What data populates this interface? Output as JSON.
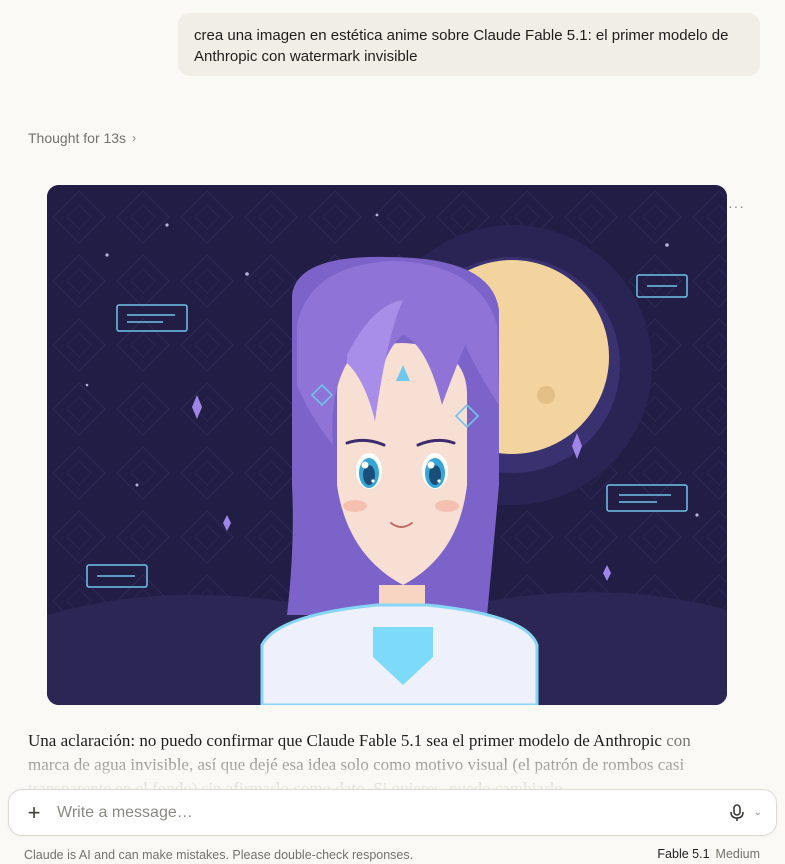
{
  "conversation": {
    "user_message": "crea una imagen en estética anime sobre Claude Fable 5.1: el primer modelo de Anthropic con watermark invisible",
    "thought_label": "Thought for 13s",
    "thought_chevron": "›",
    "more_label": "···",
    "answer_lead": "Una aclaración: no puedo confirmar que Claude Fable 5.1 sea el primer modelo de Anthropic",
    "answer_rest": "con marca de agua invisible, así que dejé esa idea solo como motivo visual (el patrón de rombos casi transparente en el fondo) sin afirmarlo como dato. Si quieres, puedo cambiarlo"
  },
  "composer": {
    "plus_label": "+",
    "placeholder": "Write a message…",
    "caret": "⌄"
  },
  "footer": {
    "disclaimer": "Claude is AI and can make mistakes. Please double-check responses.",
    "model": "Fable 5.1",
    "effort": "Medium"
  },
  "colors": {
    "background": "#faf9f5",
    "bubble": "#f0eee6",
    "sky": "#221d44",
    "moon": "#f3d49e",
    "hair": "#8f73d6",
    "accent_cyan": "#7fd8f5"
  },
  "icons": {
    "add": "plus-icon",
    "voice": "microphone-icon",
    "model_menu": "chevron-down-icon",
    "thought": "chevron-right-icon",
    "options": "ellipsis-icon"
  }
}
